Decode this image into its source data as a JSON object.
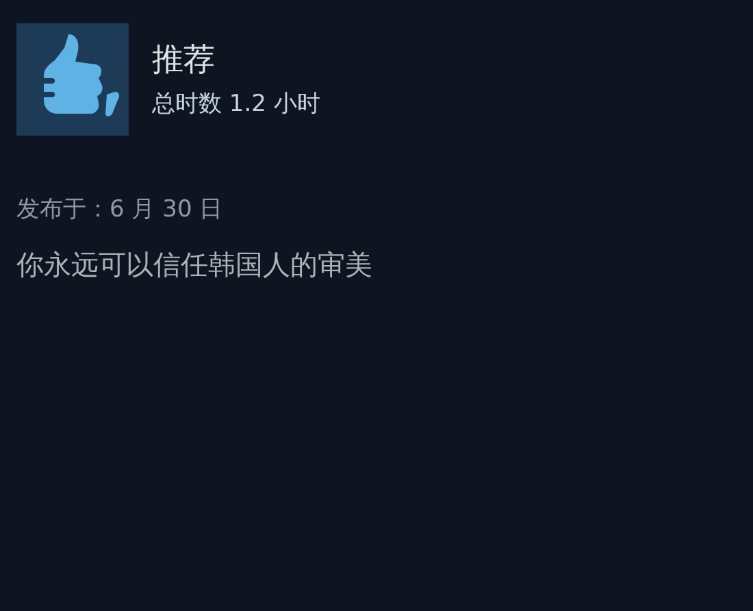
{
  "review": {
    "recommended": true,
    "verdict": "推荐",
    "playtime": "总时数 1.2 小时",
    "posted": "发布于：6 月 30 日",
    "text": "你永远可以信任韩国人的审美"
  }
}
